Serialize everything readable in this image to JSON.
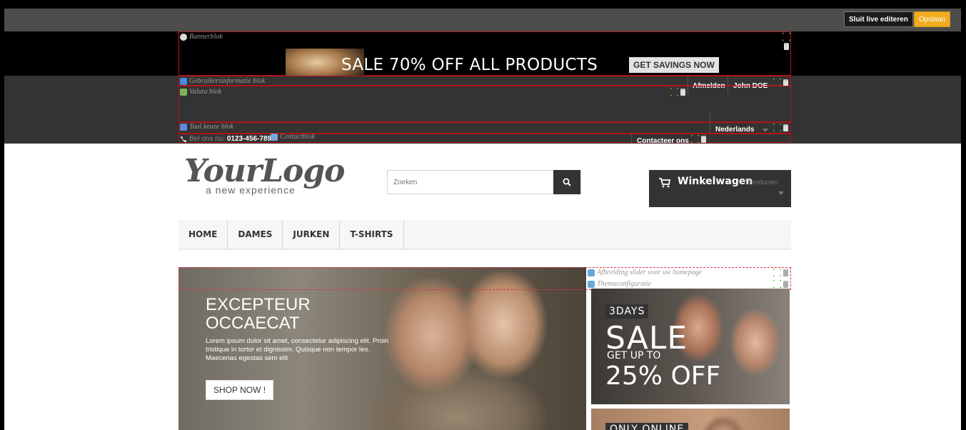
{
  "editbar": {
    "close_label": "Sluit live editeren",
    "save_label": "Opslaan",
    "save_color": "#f0ad20"
  },
  "blocks": {
    "banner": "Bannerblok",
    "userinfo": "Gebruikersinformatie blok",
    "currency": "Valuta blok",
    "language": "Taal keuze blok",
    "contact": "Contactblok",
    "slider": "Afbeelding slider voor uw homepage",
    "themeconfig": "Themaconfiguratie"
  },
  "banner": {
    "text": "SALE 70% OFF ALL PRODUCTS",
    "button": "GET SAVINGS NOW"
  },
  "userbar": {
    "logout": "Afmelden",
    "username": "John DOE"
  },
  "language": {
    "selected": "Nederlands"
  },
  "contact": {
    "phone_label": "Bel ons nu:",
    "phone_number": "0123-456-789",
    "contact_link": "Contacteer ons"
  },
  "header": {
    "logo_main": "YourLogo",
    "logo_sub": "a new experience",
    "search_placeholder": "Zoeken",
    "cart_label": "Winkelwagen",
    "cart_count": "7 Producten"
  },
  "menu": {
    "items": [
      "HOME",
      "DAMES",
      "JURKEN",
      "T-SHIRTS"
    ]
  },
  "slider": {
    "title_line1": "EXCEPTEUR",
    "title_line2": "OCCAECAT",
    "text": "Lorem ipsum dolor sit amet, consectetur adipiscing elit. Proin tristique in tortor et dignissim. Quisque non tempor leo. Maecenas egestas sem elit",
    "button": "SHOP NOW !"
  },
  "promo1": {
    "days": "3DAYS",
    "sale": "SALE",
    "getup": "GET UP TO",
    "off": "25% OFF"
  },
  "promo2": {
    "only": "ONLY ONLINE"
  }
}
